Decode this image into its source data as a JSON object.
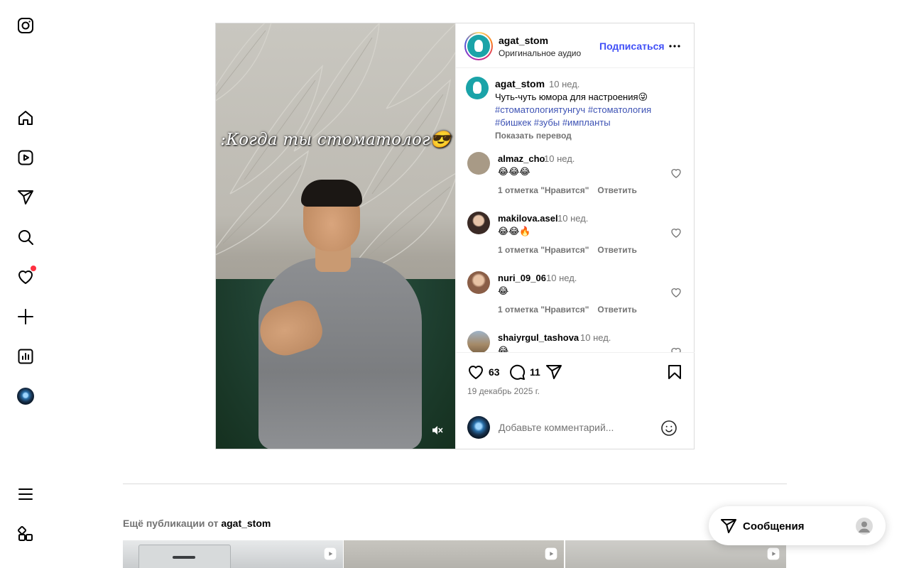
{
  "sidebar": {
    "items": [
      {
        "name": "instagram-logo-icon"
      },
      {
        "name": "home-icon"
      },
      {
        "name": "reels-icon"
      },
      {
        "name": "direct-icon"
      },
      {
        "name": "search-icon"
      },
      {
        "name": "notifications-icon"
      },
      {
        "name": "create-icon"
      },
      {
        "name": "insights-icon"
      },
      {
        "name": "profile-avatar"
      },
      {
        "name": "menu-icon"
      },
      {
        "name": "also-from-meta-icon"
      }
    ]
  },
  "post": {
    "overlay_text": ":Когда ты стоматолог😎",
    "header": {
      "username": "agat_stom",
      "audio": "Оригинальное аудио",
      "follow_label": "Подписаться"
    },
    "caption": {
      "username": "agat_stom",
      "time": "10 нед.",
      "text": "Чуть-чуть юмора для настроения😜",
      "hashtags_line1": "#стоматологиятунгуч #стоматология",
      "hashtags_line2": "#бишкек #зубы #импланты",
      "translate_label": "Показать перевод"
    },
    "comments": [
      {
        "username": "almaz_cho",
        "time": "10 нед.",
        "text": "😂😂😂",
        "likes": "1 отметка \"Нравится\"",
        "reply": "Ответить",
        "avatar_color": "#a89a86"
      },
      {
        "username": "makilova.asel",
        "time": "10 нед.",
        "text": "😂😂🔥",
        "likes": "1 отметка \"Нравится\"",
        "reply": "Ответить",
        "avatar_color": "#3a2a25"
      },
      {
        "username": "nuri_09_06",
        "time": "10 нед.",
        "text": "😂",
        "likes": "1 отметка \"Нравится\"",
        "reply": "Ответить",
        "avatar_color": "#b98d73"
      },
      {
        "username": "shaiyrgul_tashova",
        "time": "10 нед.",
        "text": "😂",
        "likes": "",
        "reply": "",
        "avatar_color": "#a58a68"
      }
    ],
    "actions": {
      "likes_count": "63",
      "comments_count": "11",
      "date": "19 декабрь 2025 г."
    },
    "add_comment": {
      "placeholder": "Добавьте комментарий..."
    }
  },
  "more_posts": {
    "prefix": "Ещё публикации от ",
    "username": "agat_stom",
    "thumbs": [
      {
        "color": "#cfd2d3"
      },
      {
        "color": "#b9b7b1"
      },
      {
        "color": "#c4c3bf"
      }
    ]
  },
  "messages_bar": {
    "label": "Сообщения"
  }
}
